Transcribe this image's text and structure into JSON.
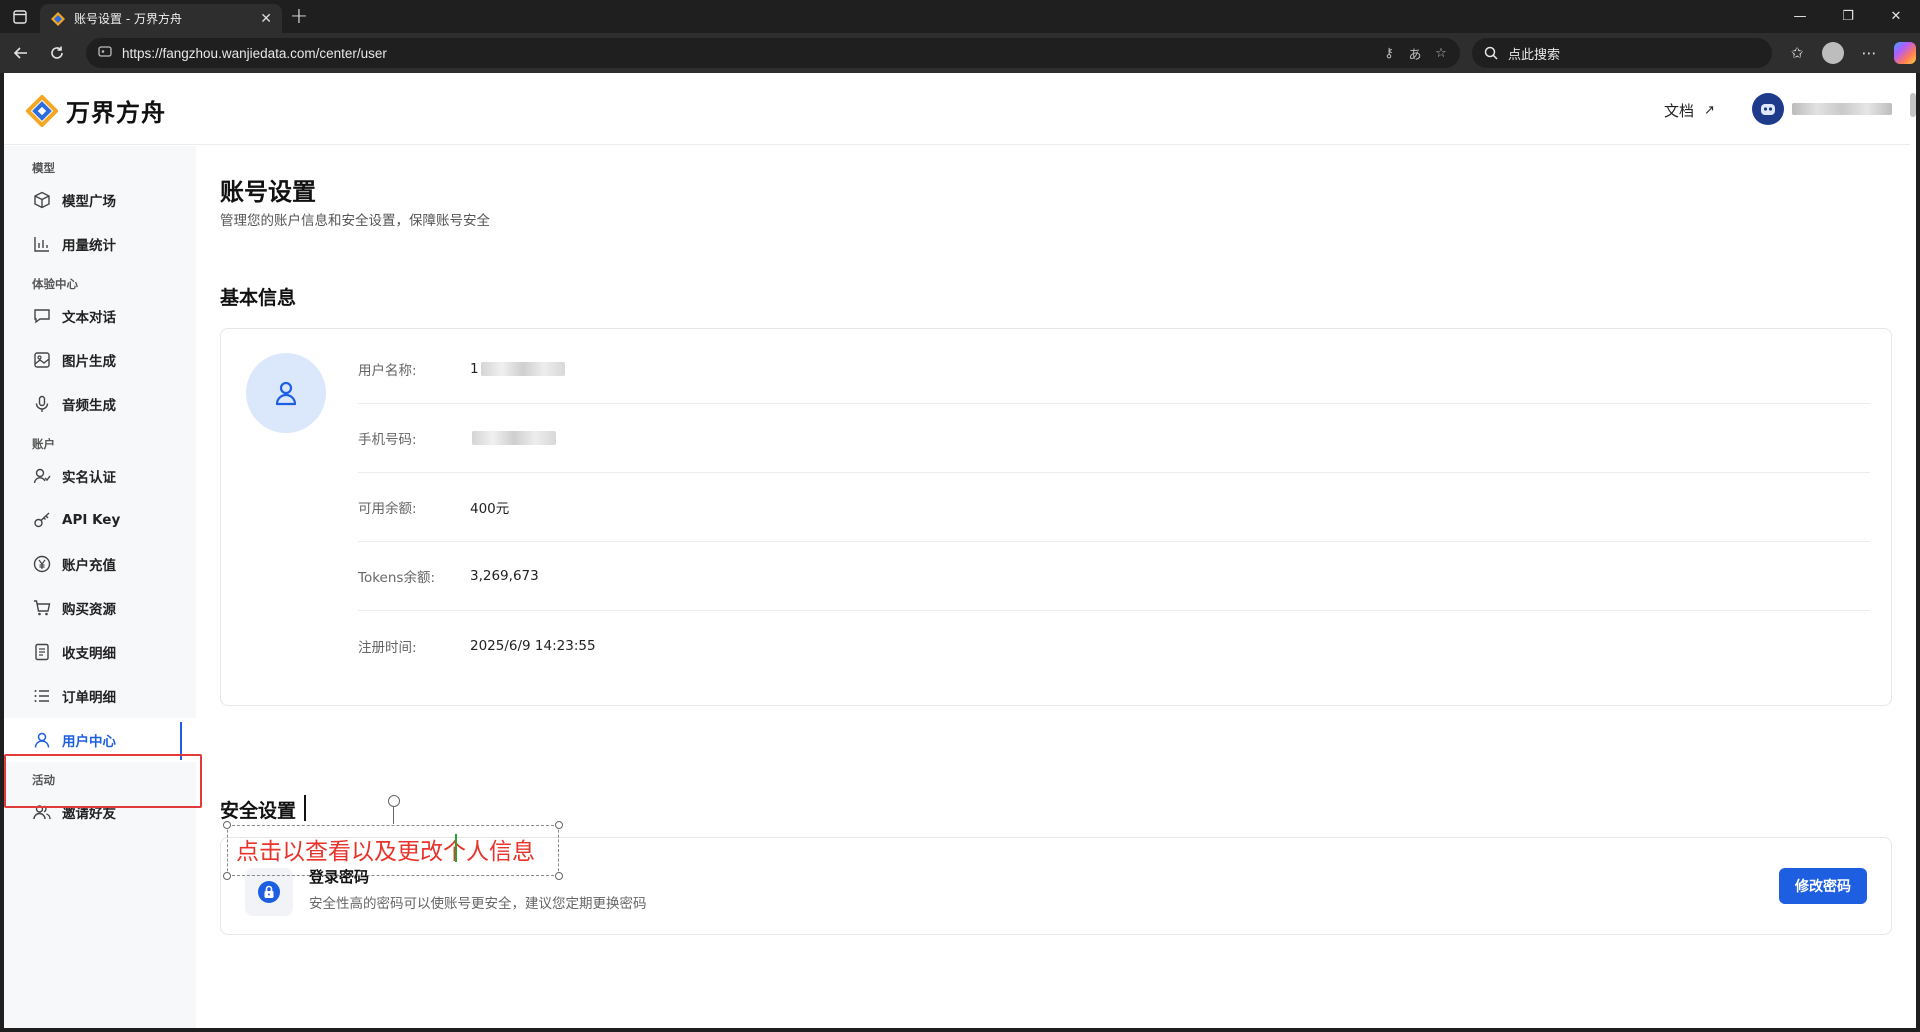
{
  "browser": {
    "tab_title": "账号设置 - 万界方舟",
    "url": "https://fangzhou.wanjiedata.com/center/user",
    "search_placeholder": "点此搜索"
  },
  "header": {
    "logo_text": "万界方舟",
    "docs_label": "文档",
    "docs_arrow": "↗"
  },
  "sidebar": {
    "groups": [
      {
        "label": "模型",
        "items": [
          {
            "label": "模型广场",
            "icon": "cube-icon"
          },
          {
            "label": "用量统计",
            "icon": "bar-chart-icon"
          }
        ]
      },
      {
        "label": "体验中心",
        "items": [
          {
            "label": "文本对话",
            "icon": "chat-icon"
          },
          {
            "label": "图片生成",
            "icon": "image-icon"
          },
          {
            "label": "音频生成",
            "icon": "mic-icon"
          }
        ]
      },
      {
        "label": "账户",
        "items": [
          {
            "label": "实名认证",
            "icon": "user-check-icon"
          },
          {
            "label": "API Key",
            "icon": "key-icon"
          },
          {
            "label": "账户充值",
            "icon": "yen-icon"
          },
          {
            "label": "购买资源",
            "icon": "cart-icon"
          },
          {
            "label": "收支明细",
            "icon": "document-icon"
          },
          {
            "label": "订单明细",
            "icon": "list-icon"
          },
          {
            "label": "用户中心",
            "icon": "user-icon",
            "active": true
          }
        ]
      },
      {
        "label": "活动",
        "items": [
          {
            "label": "邀请好友",
            "icon": "users-icon"
          }
        ]
      }
    ]
  },
  "main": {
    "title": "账号设置",
    "subtitle": "管理您的账户信息和安全设置，保障账号安全",
    "basic_section": "基本信息",
    "info_rows": [
      {
        "label": "用户名称:",
        "value": "1",
        "masked": true
      },
      {
        "label": "手机号码:",
        "value": "",
        "masked": true
      },
      {
        "label": "可用余额:",
        "value": "400元"
      },
      {
        "label": "Tokens余额:",
        "value": "3,269,673"
      },
      {
        "label": "注册时间:",
        "value": "2025/6/9 14:23:55"
      }
    ],
    "security_section": "安全设置",
    "password_title": "登录密码",
    "password_desc": "安全性高的密码可以使账号更安全，建议您定期更换密码",
    "change_password_button": "修改密码"
  },
  "annotation": {
    "text": "点击以查看以及更改个人信息",
    "color": "#e8332b"
  },
  "colors": {
    "accent": "#1d5fe0",
    "highlight_border": "#e03a3a"
  }
}
